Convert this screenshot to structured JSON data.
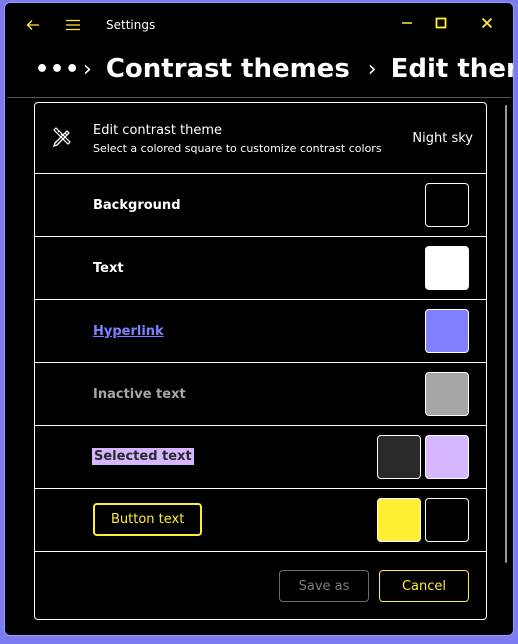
{
  "titlebar": {
    "app_title": "Settings",
    "back_icon": "arrow-left-icon",
    "menu_icon": "hamburger-menu-icon",
    "controls": [
      "minimize",
      "maximize",
      "close"
    ],
    "accent": "#ffee32"
  },
  "breadcrumb": {
    "more": "•••",
    "items": [
      "Contrast themes",
      "Edit theme"
    ]
  },
  "panel": {
    "header": {
      "icon": "pencil-ruler-icon",
      "title": "Edit contrast theme",
      "subtitle": "Select a colored square to customize contrast colors",
      "theme_name": "Night sky"
    },
    "rows": [
      {
        "label": "Background",
        "swatches": [
          "#000000"
        ]
      },
      {
        "label": "Text",
        "swatches": [
          "#ffffff"
        ]
      },
      {
        "label": "Hyperlink",
        "swatches": [
          "#8080ff"
        ]
      },
      {
        "label": "Inactive text",
        "swatches": [
          "#a6a6a6"
        ]
      },
      {
        "label": "Selected text",
        "swatches": [
          "#2a2a2a",
          "#d6b6ff"
        ]
      },
      {
        "label": "Button text",
        "swatches": [
          "#ffee32",
          "#000000"
        ]
      }
    ],
    "footer": {
      "save_label": "Save as",
      "cancel_label": "Cancel"
    }
  }
}
